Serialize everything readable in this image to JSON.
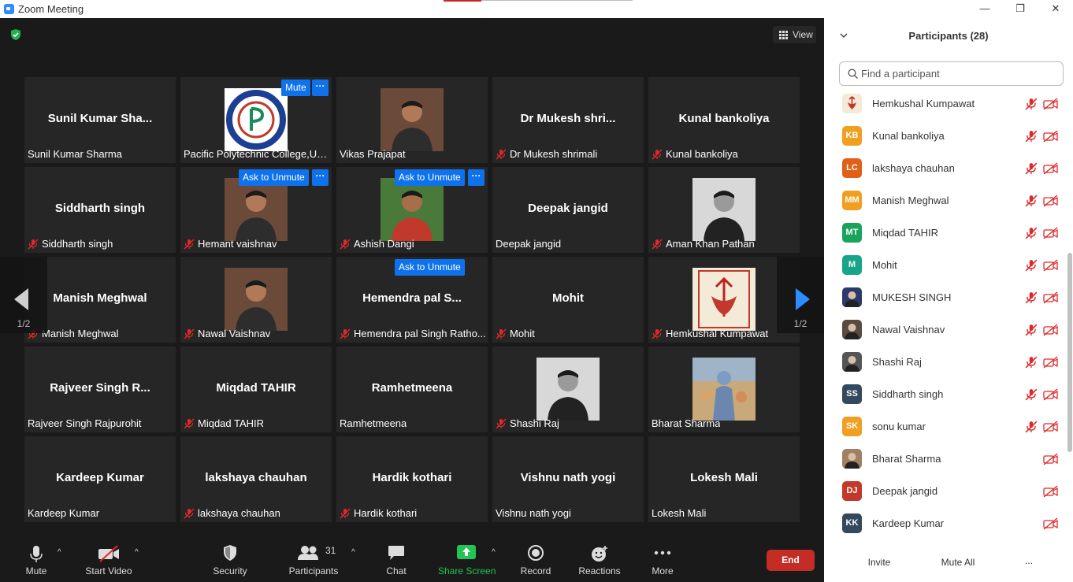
{
  "window": {
    "title": "Zoom Meeting",
    "minimize": "—",
    "restore": "❐",
    "close": "✕"
  },
  "view": {
    "label": "View"
  },
  "tiles": [
    {
      "display": "Sunil  Kumar  Sha...",
      "label": "Sunil Kumar Sharma",
      "muted": false,
      "photo": "none"
    },
    {
      "display": "",
      "label": "Pacific Polytechnic College,Ud...",
      "muted": false,
      "photo": "college-logo"
    },
    {
      "display": "",
      "label": "Vikas Prajapat",
      "muted": false,
      "photo": "person"
    },
    {
      "display": "Dr  Mukesh  shri...",
      "label": "Dr Mukesh shrimali",
      "muted": true,
      "photo": "none"
    },
    {
      "display": "Kunal bankoliya",
      "label": "Kunal bankoliya",
      "muted": true,
      "photo": "none"
    },
    {
      "display": "Siddharth singh",
      "label": "Siddharth singh",
      "muted": true,
      "photo": "none"
    },
    {
      "display": "",
      "label": "Hemant vaishnav",
      "muted": true,
      "photo": "person"
    },
    {
      "display": "",
      "label": "Ashish Dangi",
      "muted": true,
      "photo": "person-green"
    },
    {
      "display": "Deepak jangid",
      "label": "Deepak jangid",
      "muted": false,
      "photo": "none"
    },
    {
      "display": "",
      "label": "Aman Khan Pathan",
      "muted": true,
      "photo": "person-bw"
    },
    {
      "display": "Manish Meghwal",
      "label": "Manish Meghwal",
      "muted": true,
      "photo": "none"
    },
    {
      "display": "",
      "label": "Nawal Vaishnav",
      "muted": true,
      "photo": "person"
    },
    {
      "display": "Hemendra  pal  S...",
      "label": "Hemendra pal Singh Ratho...",
      "muted": true,
      "photo": "none"
    },
    {
      "display": "Mohit",
      "label": "Mohit",
      "muted": true,
      "photo": "none"
    },
    {
      "display": "",
      "label": "Hemkushal Kumpawat",
      "muted": true,
      "photo": "emblem"
    },
    {
      "display": "Rajveer  Singh  R...",
      "label": "Rajveer Singh Rajpurohit",
      "muted": false,
      "photo": "none"
    },
    {
      "display": "Miqdad TAHIR",
      "label": "Miqdad TAHIR",
      "muted": true,
      "photo": "none"
    },
    {
      "display": "Ramhetmeena",
      "label": "Ramhetmeena",
      "muted": false,
      "photo": "none"
    },
    {
      "display": "",
      "label": "Shashi Raj",
      "muted": true,
      "photo": "person-bw"
    },
    {
      "display": "",
      "label": "Bharat Sharma",
      "muted": false,
      "photo": "deity"
    },
    {
      "display": "Kardeep Kumar",
      "label": "Kardeep Kumar",
      "muted": false,
      "photo": "none"
    },
    {
      "display": "lakshaya chauhan",
      "label": "lakshaya chauhan",
      "muted": true,
      "photo": "none"
    },
    {
      "display": "Hardik kothari",
      "label": "Hardik kothari",
      "muted": true,
      "photo": "none"
    },
    {
      "display": "Vishnu nath yogi",
      "label": "Vishnu nath yogi",
      "muted": false,
      "photo": "none"
    },
    {
      "display": "Lokesh Mali",
      "label": "Lokesh Mali",
      "muted": false,
      "photo": "none"
    }
  ],
  "tile_buttons": {
    "mute": "Mute",
    "ask_unmute": "Ask to Unmute",
    "more": "···"
  },
  "pager": {
    "left": "1/2",
    "right": "1/2"
  },
  "toolbar": {
    "mute": "Mute",
    "start_video": "Start Video",
    "security": "Security",
    "participants": "Participants",
    "participants_count": "31",
    "chat": "Chat",
    "share_screen": "Share Screen",
    "record": "Record",
    "reactions": "Reactions",
    "more": "More",
    "end": "End",
    "caret": "^"
  },
  "panel": {
    "title": "Participants (28)",
    "search_placeholder": "Find a participant",
    "participants": [
      {
        "name": "Hemkushal Kumpawat",
        "initials": "",
        "color": "#ffffff",
        "avatar": "emblem",
        "mic": true
      },
      {
        "name": "Kunal bankoliya",
        "initials": "KB",
        "color": "#f0a020",
        "avatar": "initials",
        "mic": true
      },
      {
        "name": "lakshaya chauhan",
        "initials": "LC",
        "color": "#e0601a",
        "avatar": "initials",
        "mic": true
      },
      {
        "name": "Manish Meghwal",
        "initials": "MM",
        "color": "#f0a020",
        "avatar": "initials",
        "mic": true
      },
      {
        "name": "Miqdad TAHIR",
        "initials": "MT",
        "color": "#1aa35a",
        "avatar": "initials",
        "mic": true
      },
      {
        "name": "Mohit",
        "initials": "M",
        "color": "#17a589",
        "avatar": "initials",
        "mic": true
      },
      {
        "name": "MUKESH SINGH",
        "initials": "",
        "color": "#2a3a6a",
        "avatar": "photo",
        "mic": true
      },
      {
        "name": "Nawal Vaishnav",
        "initials": "",
        "color": "#5a4a40",
        "avatar": "photo",
        "mic": true
      },
      {
        "name": "Shashi Raj",
        "initials": "",
        "color": "#555555",
        "avatar": "photo",
        "mic": true
      },
      {
        "name": "Siddharth singh",
        "initials": "SS",
        "color": "#34495e",
        "avatar": "initials",
        "mic": true
      },
      {
        "name": "sonu kumar",
        "initials": "SK",
        "color": "#f0a020",
        "avatar": "initials",
        "mic": true
      },
      {
        "name": "Bharat Sharma",
        "initials": "",
        "color": "#a08060",
        "avatar": "photo",
        "mic": false
      },
      {
        "name": "Deepak jangid",
        "initials": "DJ",
        "color": "#c0392b",
        "avatar": "initials",
        "mic": false
      },
      {
        "name": "Kardeep Kumar",
        "initials": "KK",
        "color": "#34495e",
        "avatar": "initials",
        "mic": false
      }
    ],
    "invite": "Invite",
    "mute_all": "Mute All",
    "more": "..."
  }
}
